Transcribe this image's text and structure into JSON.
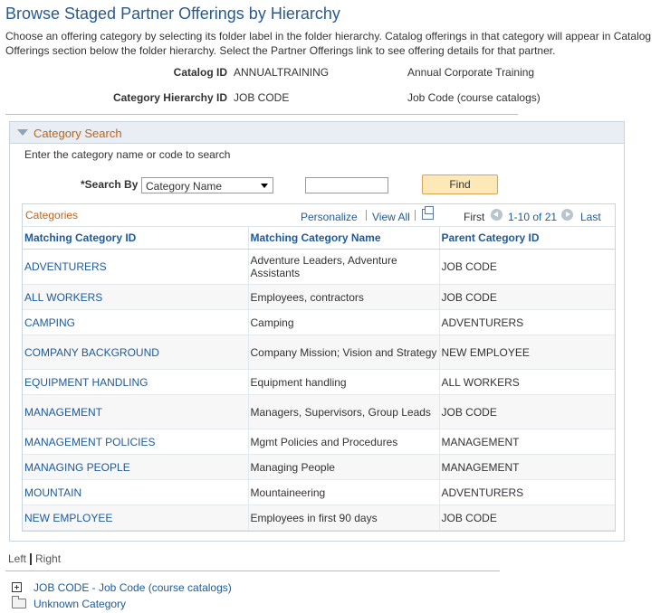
{
  "page": {
    "title": "Browse Staged Partner Offerings by Hierarchy",
    "description_lines": [
      "Choose an offering category by selecting its folder label in the folder hierarchy. Catalog offerings in that category will appear in Catalog",
      "Offerings section below the folder hierarchy. Select the Partner Offerings link to see offering details for that partner."
    ]
  },
  "catalog": {
    "label": "Catalog ID",
    "id": "ANNUALTRAINING",
    "description": "Annual Corporate Training"
  },
  "hierarchy": {
    "label": "Category Hierarchy ID",
    "id": "JOB CODE",
    "description": "Job Code (course catalogs)"
  },
  "search": {
    "section_title": "Category Search",
    "hint": "Enter the category name or code to search",
    "search_by_label": "*Search By",
    "search_by_value": "Category Name",
    "search_text": "",
    "find_label": "Find"
  },
  "grid": {
    "title": "Categories",
    "personalize": "Personalize",
    "view_all": "View All",
    "first": "First",
    "range": "1-10 of 21",
    "last": "Last",
    "columns": [
      "Matching Category ID",
      "Matching Category Name",
      "Parent Category ID"
    ],
    "rows": [
      {
        "id": "ADVENTURERS",
        "name": "Adventure Leaders, Adventure Assistants",
        "parent": "JOB CODE"
      },
      {
        "id": "ALL WORKERS",
        "name": "Employees, contractors",
        "parent": "JOB CODE"
      },
      {
        "id": "CAMPING",
        "name": "Camping",
        "parent": "ADVENTURERS"
      },
      {
        "id": "COMPANY BACKGROUND",
        "name": "Company Mission; Vision and Strategy",
        "parent": "NEW EMPLOYEE"
      },
      {
        "id": "EQUIPMENT HANDLING",
        "name": "Equipment handling",
        "parent": "ALL WORKERS"
      },
      {
        "id": "MANAGEMENT",
        "name": "Managers, Supervisors, Group Leads",
        "parent": "JOB CODE"
      },
      {
        "id": "MANAGEMENT POLICIES",
        "name": "Mgmt Policies and Procedures",
        "parent": "MANAGEMENT"
      },
      {
        "id": "MANAGING PEOPLE",
        "name": "Managing People",
        "parent": "MANAGEMENT"
      },
      {
        "id": "MOUNTAIN",
        "name": "Mountaineering",
        "parent": "ADVENTURERS"
      },
      {
        "id": "NEW EMPLOYEE",
        "name": "Employees in first 90 days",
        "parent": "JOB CODE"
      }
    ]
  },
  "tree_nav": {
    "left": "Left",
    "right": "Right"
  },
  "tree": {
    "root": "JOB CODE - Job Code (course catalogs)",
    "unknown": "Unknown Category"
  }
}
